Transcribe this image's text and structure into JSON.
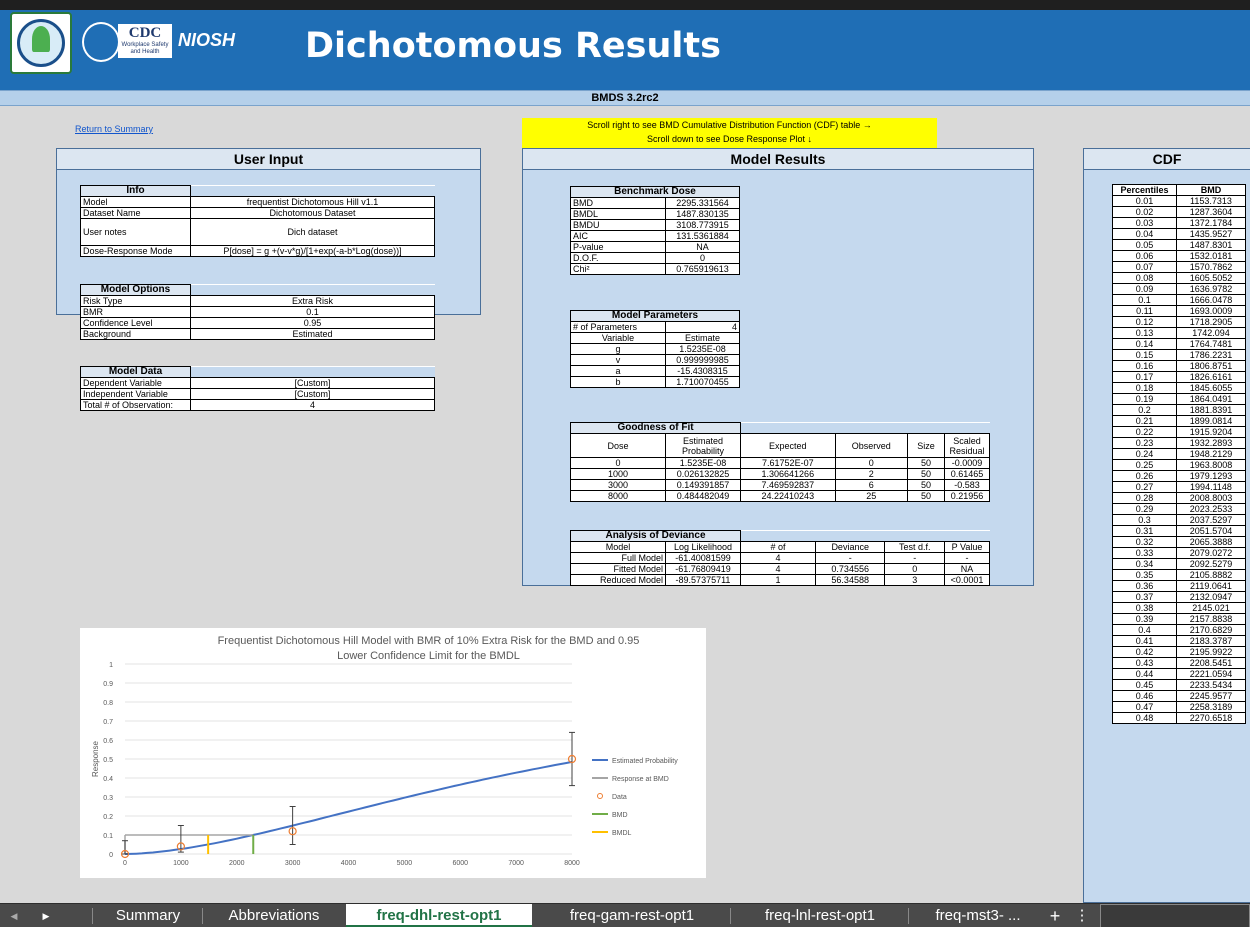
{
  "app": {
    "title": "Dichotomous Results",
    "version": "BMDS 3.2rc2",
    "return_link": "Return to Summary",
    "notice_line1": "Scroll right to see BMD Cumulative Distribution Function (CDF) table →",
    "notice_line2": "Scroll down to see Dose Response Plot ↓",
    "logos": {
      "cdc": "CDC",
      "cdc_sub": "Workplace Safety and Health",
      "niosh": "NIOSH"
    }
  },
  "user_input": {
    "header": "User Input",
    "info": {
      "caption": "Info",
      "rows": [
        {
          "label": "Model",
          "value": "frequentist Dichotomous Hill v1.1"
        },
        {
          "label": "Dataset Name",
          "value": "Dichotomous Dataset"
        },
        {
          "label": "User notes",
          "value": "Dich dataset"
        },
        {
          "label": "Dose-Response Mode",
          "value": "P[dose] = g +(v-v*g)/[1+exp(-a-b*Log(dose))]"
        }
      ]
    },
    "options": {
      "caption": "Model Options",
      "rows": [
        {
          "label": "Risk Type",
          "value": "Extra Risk"
        },
        {
          "label": "BMR",
          "value": "0.1"
        },
        {
          "label": "Confidence Level",
          "value": "0.95"
        },
        {
          "label": "Background",
          "value": "Estimated"
        }
      ]
    },
    "data": {
      "caption": "Model Data",
      "rows": [
        {
          "label": "Dependent Variable",
          "value": "[Custom]"
        },
        {
          "label": "Independent Variable",
          "value": "[Custom]"
        },
        {
          "label": "Total # of Observation:",
          "value": "4"
        }
      ]
    }
  },
  "model_results": {
    "header": "Model Results",
    "benchmark": {
      "caption": "Benchmark Dose",
      "rows": [
        {
          "label": "BMD",
          "value": "2295.331564"
        },
        {
          "label": "BMDL",
          "value": "1487.830135"
        },
        {
          "label": "BMDU",
          "value": "3108.773915"
        },
        {
          "label": "AIC",
          "value": "131.5361884"
        },
        {
          "label": "P-value",
          "value": "NA"
        },
        {
          "label": "D.O.F.",
          "value": "0"
        },
        {
          "label": "Chi²",
          "value": "0.765919613"
        }
      ]
    },
    "parameters": {
      "caption": "Model Parameters",
      "count_label": "# of Parameters",
      "count_value": "4",
      "col_variable": "Variable",
      "col_estimate": "Estimate",
      "rows": [
        {
          "variable": "g",
          "estimate": "1.5235E-08"
        },
        {
          "variable": "v",
          "estimate": "0.999999985"
        },
        {
          "variable": "a",
          "estimate": "-15.4308315"
        },
        {
          "variable": "b",
          "estimate": "1.710070455"
        }
      ]
    },
    "fit": {
      "caption": "Goodness of Fit",
      "columns": [
        "Dose",
        "Estimated Probability",
        "Expected",
        "Observed",
        "Size",
        "Scaled Residual"
      ],
      "rows": [
        [
          "0",
          "1.5235E-08",
          "7.61752E-07",
          "0",
          "50",
          "-0.0009"
        ],
        [
          "1000",
          "0.026132825",
          "1.306641266",
          "2",
          "50",
          "0.61465"
        ],
        [
          "3000",
          "0.149391857",
          "7.469592837",
          "6",
          "50",
          "-0.583"
        ],
        [
          "8000",
          "0.484482049",
          "24.22410243",
          "25",
          "50",
          "0.21956"
        ]
      ]
    },
    "deviance": {
      "caption": "Analysis of Deviance",
      "columns": [
        "Model",
        "Log Likelihood",
        "# of",
        "Deviance",
        "Test d.f.",
        "P Value"
      ],
      "rows": [
        [
          "Full Model",
          "-61.40081599",
          "4",
          "-",
          "-",
          "-"
        ],
        [
          "Fitted Model",
          "-61.76809419",
          "4",
          "0.734556",
          "0",
          "NA"
        ],
        [
          "Reduced Model",
          "-89.57375711",
          "1",
          "56.34588",
          "3",
          "<0.0001"
        ]
      ]
    }
  },
  "cdf": {
    "header": "CDF",
    "col_percentiles": "Percentiles",
    "col_bmd": "BMD",
    "rows": [
      [
        "0.01",
        "1153.7313"
      ],
      [
        "0.02",
        "1287.3604"
      ],
      [
        "0.03",
        "1372.1784"
      ],
      [
        "0.04",
        "1435.9527"
      ],
      [
        "0.05",
        "1487.8301"
      ],
      [
        "0.06",
        "1532.0181"
      ],
      [
        "0.07",
        "1570.7862"
      ],
      [
        "0.08",
        "1605.5052"
      ],
      [
        "0.09",
        "1636.9782"
      ],
      [
        "0.1",
        "1666.0478"
      ],
      [
        "0.11",
        "1693.0009"
      ],
      [
        "0.12",
        "1718.2905"
      ],
      [
        "0.13",
        "1742.094"
      ],
      [
        "0.14",
        "1764.7481"
      ],
      [
        "0.15",
        "1786.2231"
      ],
      [
        "0.16",
        "1806.8751"
      ],
      [
        "0.17",
        "1826.6161"
      ],
      [
        "0.18",
        "1845.6055"
      ],
      [
        "0.19",
        "1864.0491"
      ],
      [
        "0.2",
        "1881.8391"
      ],
      [
        "0.21",
        "1899.0814"
      ],
      [
        "0.22",
        "1915.9204"
      ],
      [
        "0.23",
        "1932.2893"
      ],
      [
        "0.24",
        "1948.2129"
      ],
      [
        "0.25",
        "1963.8008"
      ],
      [
        "0.26",
        "1979.1293"
      ],
      [
        "0.27",
        "1994.1148"
      ],
      [
        "0.28",
        "2008.8003"
      ],
      [
        "0.29",
        "2023.2533"
      ],
      [
        "0.3",
        "2037.5297"
      ],
      [
        "0.31",
        "2051.5704"
      ],
      [
        "0.32",
        "2065.3888"
      ],
      [
        "0.33",
        "2079.0272"
      ],
      [
        "0.34",
        "2092.5279"
      ],
      [
        "0.35",
        "2105.8882"
      ],
      [
        "0.36",
        "2119.0641"
      ],
      [
        "0.37",
        "2132.0947"
      ],
      [
        "0.38",
        "2145.021"
      ],
      [
        "0.39",
        "2157.8838"
      ],
      [
        "0.4",
        "2170.6829"
      ],
      [
        "0.41",
        "2183.3787"
      ],
      [
        "0.42",
        "2195.9922"
      ],
      [
        "0.43",
        "2208.5451"
      ],
      [
        "0.44",
        "2221.0594"
      ],
      [
        "0.45",
        "2233.5434"
      ],
      [
        "0.46",
        "2245.9577"
      ],
      [
        "0.47",
        "2258.3189"
      ],
      [
        "0.48",
        "2270.6518"
      ]
    ]
  },
  "chart_data": {
    "type": "line",
    "title_line1": "Frequentist Dichotomous Hill Model with BMR of 10% Extra Risk for the BMD and 0.95",
    "title_line2": "Lower Confidence Limit for the BMDL",
    "ylabel": "Response",
    "xlim": [
      0,
      8000
    ],
    "ylim": [
      0,
      1
    ],
    "x_ticks": [
      "0",
      "1000",
      "2000",
      "3000",
      "4000",
      "5000",
      "6000",
      "7000",
      "8000"
    ],
    "y_ticks": [
      "0",
      "0.1",
      "0.2",
      "0.3",
      "0.4",
      "0.5",
      "0.6",
      "0.7",
      "0.8",
      "0.9",
      "1"
    ],
    "legend": [
      "Estimated Probability",
      "Response at BMD",
      "Data",
      "BMD",
      "BMDL"
    ],
    "legend_colors": [
      "#4472c4",
      "#a5a5a5",
      "#ed7d31",
      "#70ad47",
      "#ffc000"
    ],
    "data_points": [
      {
        "x": 0,
        "y": 0,
        "lo": 0,
        "hi": 0.07
      },
      {
        "x": 1000,
        "y": 0.04,
        "lo": 0.01,
        "hi": 0.15
      },
      {
        "x": 3000,
        "y": 0.12,
        "lo": 0.05,
        "hi": 0.25
      },
      {
        "x": 8000,
        "y": 0.5,
        "lo": 0.36,
        "hi": 0.64
      }
    ],
    "bmd": 2295.33,
    "bmdl": 1487.83,
    "bmr_response": 0.1
  },
  "sheet_tabs": {
    "tabs": [
      "Summary",
      "Abbreviations",
      "freq-dhl-rest-opt1",
      "freq-gam-rest-opt1",
      "freq-lnl-rest-opt1",
      "freq-mst3- ..."
    ],
    "active": 2,
    "add_symbol": "+",
    "more_symbol": "⋮",
    "prev_symbol": "◀",
    "next_symbol": "▶"
  }
}
